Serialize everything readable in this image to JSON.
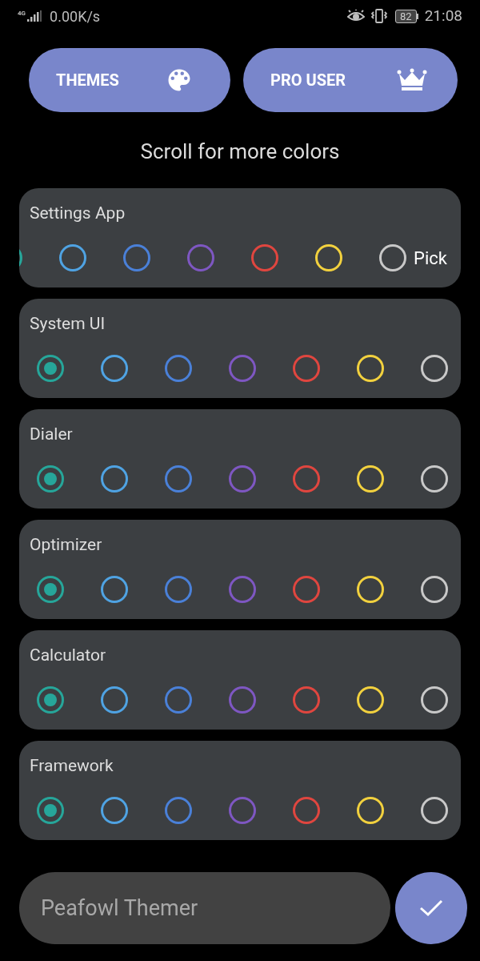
{
  "status_bar": {
    "network": "4G",
    "speed": "0.00K/s",
    "battery": "82",
    "time": "21:08"
  },
  "buttons": [
    {
      "label": "THEMES",
      "kind": "palette"
    },
    {
      "label": "PRO USER",
      "kind": "crown"
    }
  ],
  "hint": "Scroll for more colors",
  "cards": [
    {
      "title": "Settings App",
      "scrolled": true,
      "pick": "Pick",
      "swatches": [
        {
          "color": "#26a69a"
        },
        {
          "color": "#4fa3e3",
          "selected": false
        },
        {
          "color": "#4a80d8",
          "selected": false
        },
        {
          "color": "#7e57c2",
          "selected": false
        },
        {
          "color": "#e0463f",
          "selected": false
        },
        {
          "color": "#f2d13e",
          "selected": false
        },
        {
          "color": "#c8c8c8",
          "selected": false
        }
      ]
    },
    {
      "title": "System UI",
      "scrolled": false,
      "swatches": [
        {
          "color": "#26a69a",
          "selected": true
        },
        {
          "color": "#4fa3e3",
          "selected": false
        },
        {
          "color": "#4a80d8",
          "selected": false
        },
        {
          "color": "#7e57c2",
          "selected": false
        },
        {
          "color": "#e0463f",
          "selected": false
        },
        {
          "color": "#f2d13e",
          "selected": false
        },
        {
          "color": "#c8c8c8",
          "selected": false
        }
      ]
    },
    {
      "title": "Dialer",
      "scrolled": false,
      "swatches": [
        {
          "color": "#26a69a",
          "selected": true
        },
        {
          "color": "#4fa3e3",
          "selected": false
        },
        {
          "color": "#4a80d8",
          "selected": false
        },
        {
          "color": "#7e57c2",
          "selected": false
        },
        {
          "color": "#e0463f",
          "selected": false
        },
        {
          "color": "#f2d13e",
          "selected": false
        },
        {
          "color": "#c8c8c8",
          "selected": false
        }
      ]
    },
    {
      "title": "Optimizer",
      "scrolled": false,
      "swatches": [
        {
          "color": "#26a69a",
          "selected": true
        },
        {
          "color": "#4fa3e3",
          "selected": false
        },
        {
          "color": "#4a80d8",
          "selected": false
        },
        {
          "color": "#7e57c2",
          "selected": false
        },
        {
          "color": "#e0463f",
          "selected": false
        },
        {
          "color": "#f2d13e",
          "selected": false
        },
        {
          "color": "#c8c8c8",
          "selected": false
        }
      ]
    },
    {
      "title": "Calculator",
      "scrolled": false,
      "swatches": [
        {
          "color": "#26a69a",
          "selected": true
        },
        {
          "color": "#4fa3e3",
          "selected": false
        },
        {
          "color": "#4a80d8",
          "selected": false
        },
        {
          "color": "#7e57c2",
          "selected": false
        },
        {
          "color": "#e0463f",
          "selected": false
        },
        {
          "color": "#f2d13e",
          "selected": false
        },
        {
          "color": "#c8c8c8",
          "selected": false
        }
      ]
    },
    {
      "title": "Framework",
      "scrolled": false,
      "swatches": [
        {
          "color": "#26a69a",
          "selected": true
        },
        {
          "color": "#4fa3e3",
          "selected": false
        },
        {
          "color": "#4a80d8",
          "selected": false
        },
        {
          "color": "#7e57c2",
          "selected": false
        },
        {
          "color": "#e0463f",
          "selected": false
        },
        {
          "color": "#f2d13e",
          "selected": false
        },
        {
          "color": "#c8c8c8",
          "selected": false
        }
      ]
    }
  ],
  "name_field": {
    "placeholder": "Peafowl Themer"
  }
}
